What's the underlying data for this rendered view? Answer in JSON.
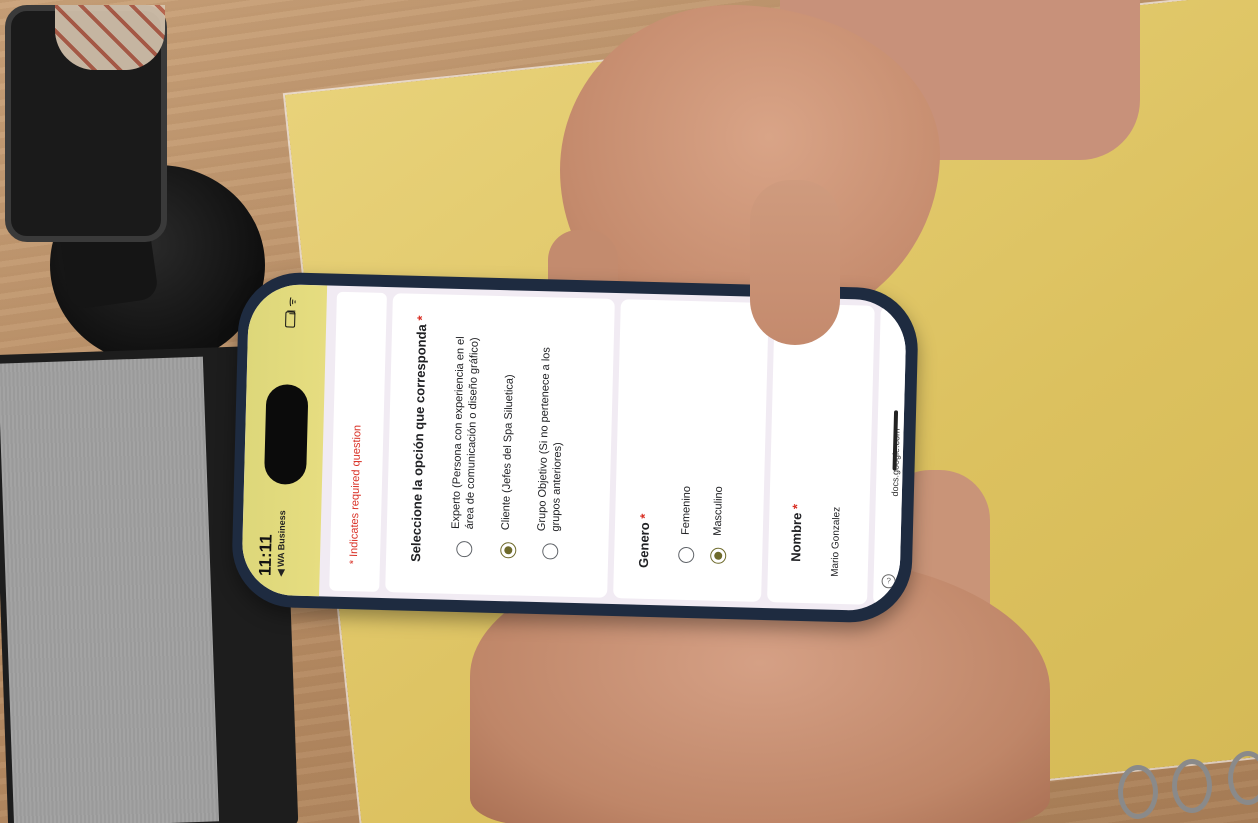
{
  "status_bar": {
    "time": "11:11",
    "app_back": "◀ WA Business"
  },
  "form": {
    "required_note": "* Indicates required question",
    "questions": [
      {
        "title": "Seleccione la opción que corresponda",
        "required_mark": "*",
        "options": [
          {
            "label_line1": "Experto (Persona con experiencia en el",
            "label_line2": "área de comunicación o diseño gráfico)",
            "selected": false
          },
          {
            "label_line1": "Cliente (Jefes del Spa Siluetica)",
            "label_line2": "",
            "selected": true
          },
          {
            "label_line1": "Grupo Objetivo (Si no pertenece a los",
            "label_line2": "grupos anteriores)",
            "selected": false
          }
        ]
      },
      {
        "title": "Genero",
        "required_mark": "*",
        "options": [
          {
            "label_line1": "Femenino",
            "selected": false
          },
          {
            "label_line1": "Masculino",
            "selected": true
          }
        ]
      },
      {
        "title": "Nombre",
        "required_mark": "*",
        "answer": "Mario Gonzalez"
      }
    ],
    "url": "docs.google.com"
  },
  "colors": {
    "status_bar": "#e2da7d",
    "required": "#d93025",
    "radio_selected": "#6e6a2b",
    "phone_case": "#1e2b40",
    "notebook": "#dcc15f"
  }
}
